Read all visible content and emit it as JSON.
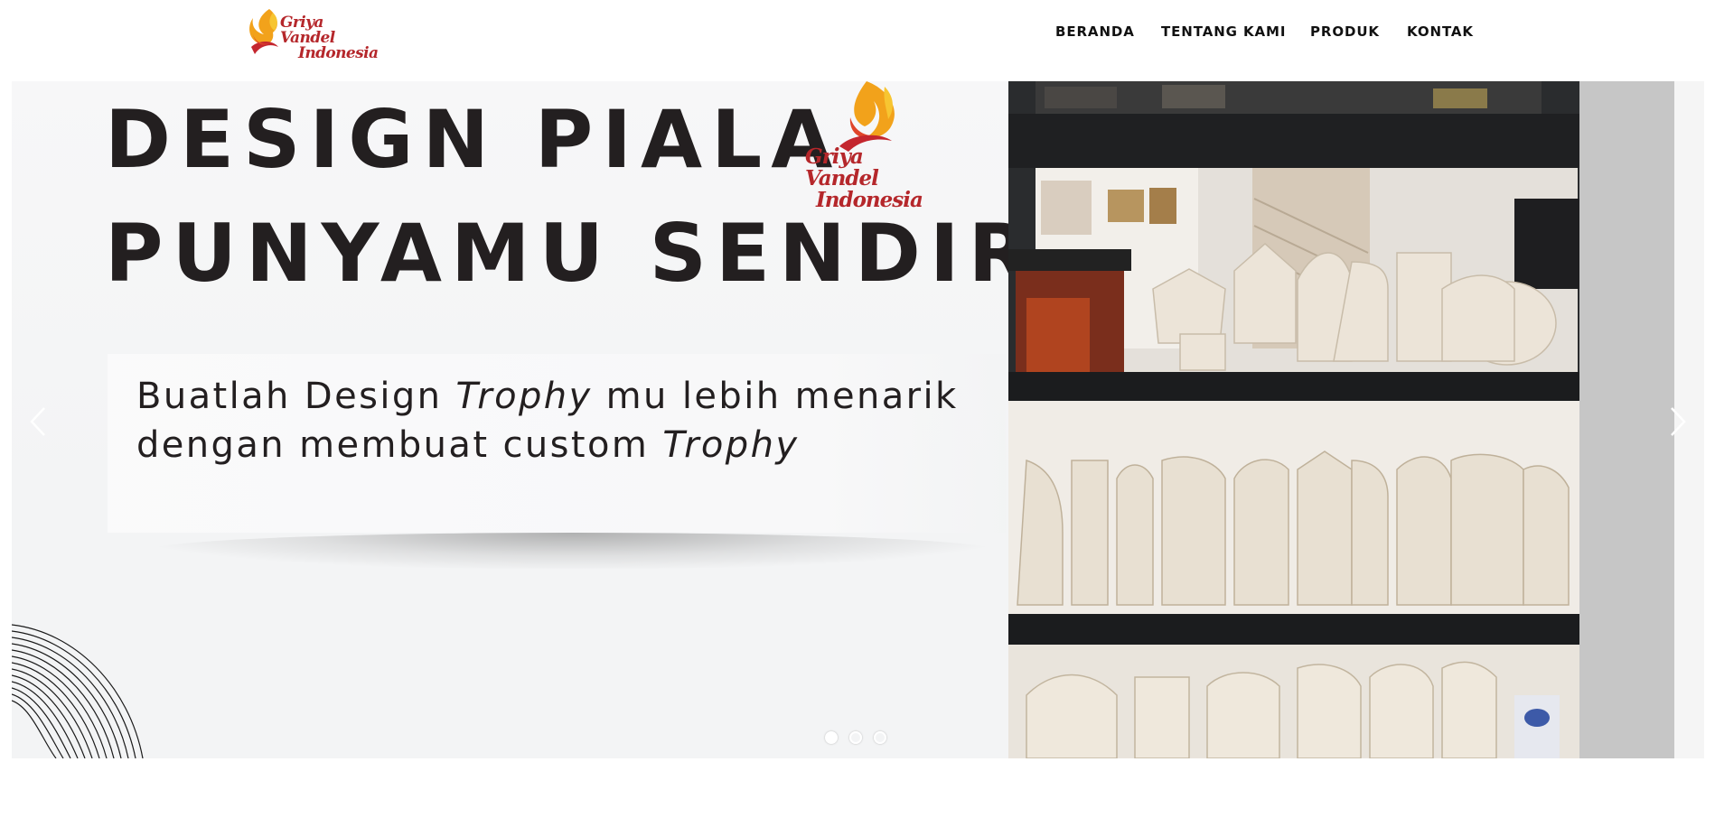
{
  "header": {
    "logo": {
      "line1": "Griya Vandel",
      "line2": "Indonesia"
    },
    "nav": [
      {
        "label": "BERANDA"
      },
      {
        "label": "TENTANG KAMI"
      },
      {
        "label": "PRODUK"
      },
      {
        "label": "KONTAK"
      }
    ]
  },
  "slider": {
    "headline_line1": "DESIGN PIALA",
    "headline_line2": "PUNYAMU SENDIRI",
    "slide_logo": {
      "line1": "Griya Vandel",
      "line2": "Indonesia"
    },
    "subtitle": {
      "p1": "Buatlah Design ",
      "e1": "Trophy",
      "p2": " mu lebih menarik dengan membuat custom ",
      "e2": "Trophy"
    },
    "slide_count": 3,
    "active_slide": 1,
    "prev_icon": "chevron-left-icon",
    "next_icon": "chevron-right-icon"
  },
  "colors": {
    "brand_red": "#b5272b",
    "brand_orange": "#f2a21b",
    "headline": "#231f20"
  }
}
